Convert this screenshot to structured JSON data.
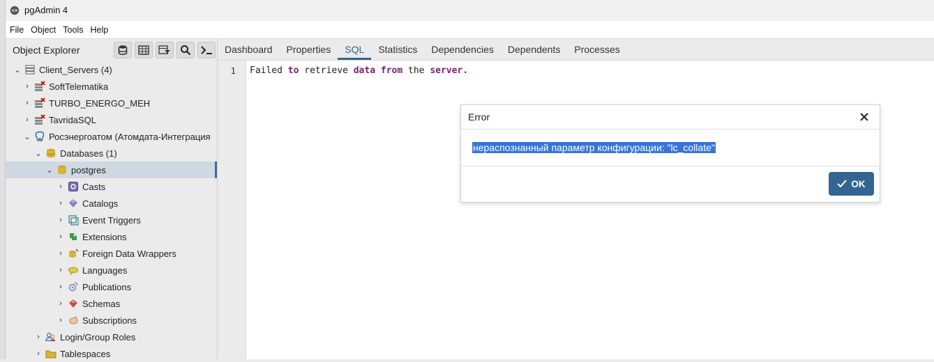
{
  "app": {
    "title": "pgAdmin 4"
  },
  "menu": [
    "File",
    "Object",
    "Tools",
    "Help"
  ],
  "explorer": {
    "title": "Object Explorer",
    "nodes": [
      {
        "label": "Client_Servers (4)"
      },
      {
        "label": "SoftTelematika"
      },
      {
        "label": "TURBO_ENERGO_MEH"
      },
      {
        "label": "TavridaSQL"
      },
      {
        "label": "Росэнергоатом (Атомдата-Интеграция"
      },
      {
        "label": "Databases (1)"
      },
      {
        "label": "postgres"
      },
      {
        "label": "Casts"
      },
      {
        "label": "Catalogs"
      },
      {
        "label": "Event Triggers"
      },
      {
        "label": "Extensions"
      },
      {
        "label": "Foreign Data Wrappers"
      },
      {
        "label": "Languages"
      },
      {
        "label": "Publications"
      },
      {
        "label": "Schemas"
      },
      {
        "label": "Subscriptions"
      },
      {
        "label": "Login/Group Roles"
      },
      {
        "label": "Tablespaces"
      }
    ]
  },
  "tabs": [
    "Dashboard",
    "Properties",
    "SQL",
    "Statistics",
    "Dependencies",
    "Dependents",
    "Processes"
  ],
  "editor": {
    "line_number": "1",
    "tokens": [
      "Failed",
      "to",
      "retrieve",
      "data",
      "from",
      "the",
      "server."
    ]
  },
  "dialog": {
    "title": "Error",
    "message": "нераспознанный параметр конфигурации: \"lc_collate\"",
    "ok_label": "OK"
  },
  "colors": {
    "accent": "#326690",
    "selection": "#3875d7",
    "keyword": "#7a1d73"
  }
}
